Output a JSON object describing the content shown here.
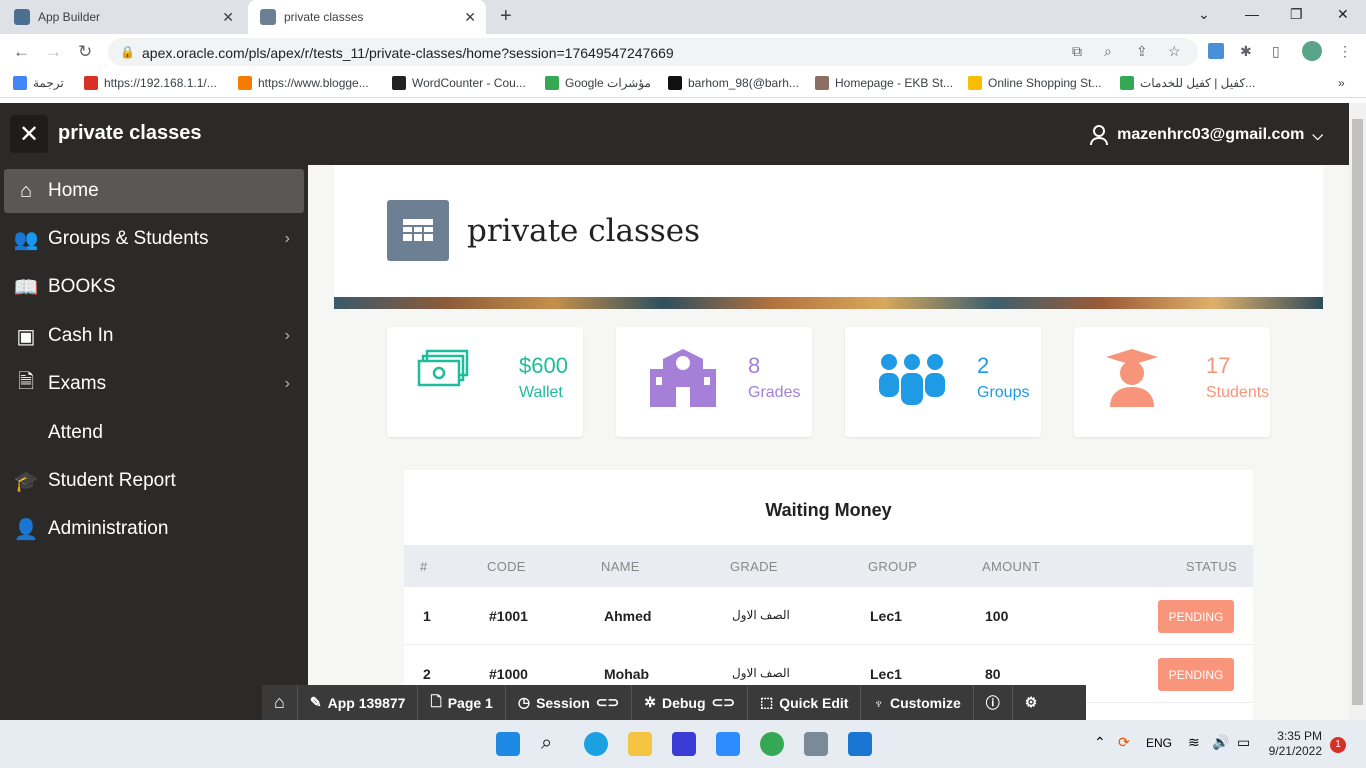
{
  "browser": {
    "tabs": [
      {
        "label": "App Builder"
      },
      {
        "label": "private classes"
      }
    ],
    "url": "apex.oracle.com/pls/apex/r/tests_11/private-classes/home?session=17649547247669",
    "bookmarks": [
      {
        "label": "ترجمة"
      },
      {
        "label": "https://192.168.1.1/..."
      },
      {
        "label": "https://www.blogge..."
      },
      {
        "label": "WordCounter - Cou..."
      },
      {
        "label": "Google مؤشرات"
      },
      {
        "label": "barhom_98(@barh..."
      },
      {
        "label": "Homepage - EKB St..."
      },
      {
        "label": "Online Shopping St..."
      },
      {
        "label": "كفيل | كفيل للخدمات..."
      }
    ]
  },
  "header": {
    "title": "private classes",
    "user": "mazenhrc03@gmail.com"
  },
  "sidebar": {
    "items": [
      {
        "label": "Home",
        "icon": "home-icon"
      },
      {
        "label": "Groups & Students",
        "icon": "users-icon"
      },
      {
        "label": "BOOKS",
        "icon": "book-icon"
      },
      {
        "label": "Cash In",
        "icon": "cash-icon"
      },
      {
        "label": "Exams",
        "icon": "document-icon"
      },
      {
        "label": "Attend",
        "icon": ""
      },
      {
        "label": "Student Report",
        "icon": "graduation-cap-icon"
      },
      {
        "label": "Administration",
        "icon": "user-key-icon"
      }
    ]
  },
  "hero": {
    "title": "private classes"
  },
  "cards": [
    {
      "value": "$600",
      "label": "Wallet",
      "color": "#1fbc9c",
      "icon": "money-icon"
    },
    {
      "value": "8",
      "label": "Grades",
      "color": "#a57fd8",
      "icon": "school-icon"
    },
    {
      "value": "2",
      "label": "Groups",
      "color": "#1e9be4",
      "icon": "group-icon"
    },
    {
      "value": "17",
      "label": "Students",
      "color": "#f6957a",
      "icon": "student-icon"
    }
  ],
  "table": {
    "title": "Waiting Money",
    "headers": [
      "#",
      "CODE",
      "NAME",
      "GRADE",
      "GROUP",
      "AMOUNT",
      "STATUS"
    ],
    "rows": [
      {
        "num": "1",
        "code": "#1001",
        "name": "Ahmed",
        "grade": "الصف الاول",
        "group": "Lec1",
        "amount": "100",
        "status": "PENDING"
      },
      {
        "num": "2",
        "code": "#1000",
        "name": "Mohab",
        "grade": "الصف الاول",
        "group": "Lec1",
        "amount": "80",
        "status": "PENDING"
      }
    ]
  },
  "devbar": {
    "app": "App 139877",
    "page": "Page 1",
    "session": "Session",
    "debug": "Debug",
    "quick_edit": "Quick Edit",
    "customize": "Customize"
  },
  "taskbar": {
    "lang": "ENG",
    "time": "3:35 PM",
    "date": "9/21/2022",
    "notifications": "1"
  }
}
